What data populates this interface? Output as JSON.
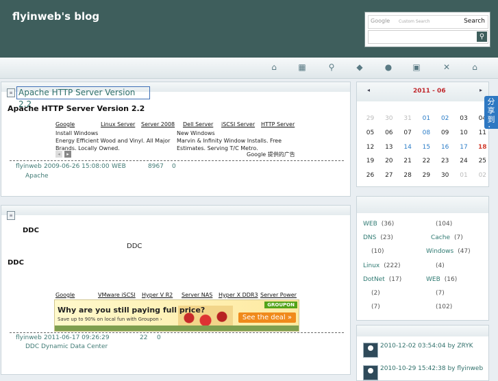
{
  "header": {
    "title": "flyinweb's blog"
  },
  "search": {
    "google_label": "Google",
    "custom_label": "Custom Search",
    "button_label": "Search",
    "go_glyph": "⚲"
  },
  "nav": {
    "icons": [
      "home-icon",
      "calendar-icon",
      "search-icon",
      "tag-icon",
      "chat-icon",
      "note-icon",
      "tools-icon",
      "home-icon"
    ]
  },
  "posts": [
    {
      "title_link": "Apache HTTP Server Version 2.2",
      "heading": "Apache HTTP Server Version 2.2",
      "ad_links": [
        "Google",
        "Linux Server",
        "Server 2008",
        "Dell Server",
        "iSCSI Server",
        "HTTP Server"
      ],
      "ad_left_title": "Install Windows",
      "ad_left_body": "Energy Efficient Wood and Vinyl. All Major Brands. Locally Owned.",
      "ad_right_title": "New Windows",
      "ad_right_body": "Marvin & Infinity Window Installs. Free Estimates. Serving T/C Metro.",
      "ad_footer": "Google 提供的广告",
      "meta": {
        "author": "flyinweb",
        "date": "2009-06-26 15:08:00",
        "category": "WEB",
        "views": "8967",
        "comments": "0"
      },
      "tag": "Apache"
    },
    {
      "heading": "DDC",
      "subheading": "DDC",
      "center_text": "DDC",
      "ad_links": [
        "Google",
        "VMware iSCSI",
        "Hyper V R2",
        "Server NAS",
        "Hyper X DDR3",
        "Server Power"
      ],
      "banner": {
        "headline": "Why are you still paying full price?",
        "sub": "Save up to 90% on local fun with Groupon ›",
        "logo": "GROUPON",
        "cta": "See the deal »"
      },
      "meta": {
        "author": "flyinweb",
        "date": "2011-06-17 09:26:29",
        "views": "22",
        "comments": "0"
      },
      "tag": "DDC Dynamic Data Center"
    }
  ],
  "calendar": {
    "month": "2011 - 06",
    "prev": "◂",
    "next": "▸",
    "weeks": [
      [
        "29",
        "30",
        "31",
        "01",
        "02",
        "03",
        "04"
      ],
      [
        "05",
        "06",
        "07",
        "08",
        "09",
        "10",
        "11"
      ],
      [
        "12",
        "13",
        "14",
        "15",
        "16",
        "17",
        "18"
      ],
      [
        "19",
        "20",
        "21",
        "22",
        "23",
        "24",
        "25"
      ],
      [
        "26",
        "27",
        "28",
        "29",
        "30",
        "01",
        "02"
      ]
    ]
  },
  "categories": {
    "left": [
      {
        "name": "WEB",
        "count": "(36)"
      },
      {
        "name": "DNS",
        "count": "(23)"
      },
      {
        "name": "",
        "count": "(10)"
      },
      {
        "name": "Linux",
        "count": "(222)"
      },
      {
        "name": "DotNet",
        "count": "(17)"
      },
      {
        "name": "",
        "count": "(2)"
      },
      {
        "name": "",
        "count": "(7)"
      }
    ],
    "right": [
      {
        "name": "",
        "count": "(104)"
      },
      {
        "name": "Cache",
        "count": "(7)"
      },
      {
        "name": "Windows",
        "count": "(47)"
      },
      {
        "name": "",
        "count": "(4)"
      },
      {
        "name": "WEB",
        "count": "(16)"
      },
      {
        "name": "",
        "count": "(7)"
      },
      {
        "name": "",
        "count": "(102)"
      }
    ]
  },
  "comments": [
    {
      "text": "2010-12-02 03:54:04 by ZRYK"
    },
    {
      "text": "2010-10-29 15:42:38 by flyinweb"
    }
  ],
  "share": {
    "label": "分享到："
  }
}
